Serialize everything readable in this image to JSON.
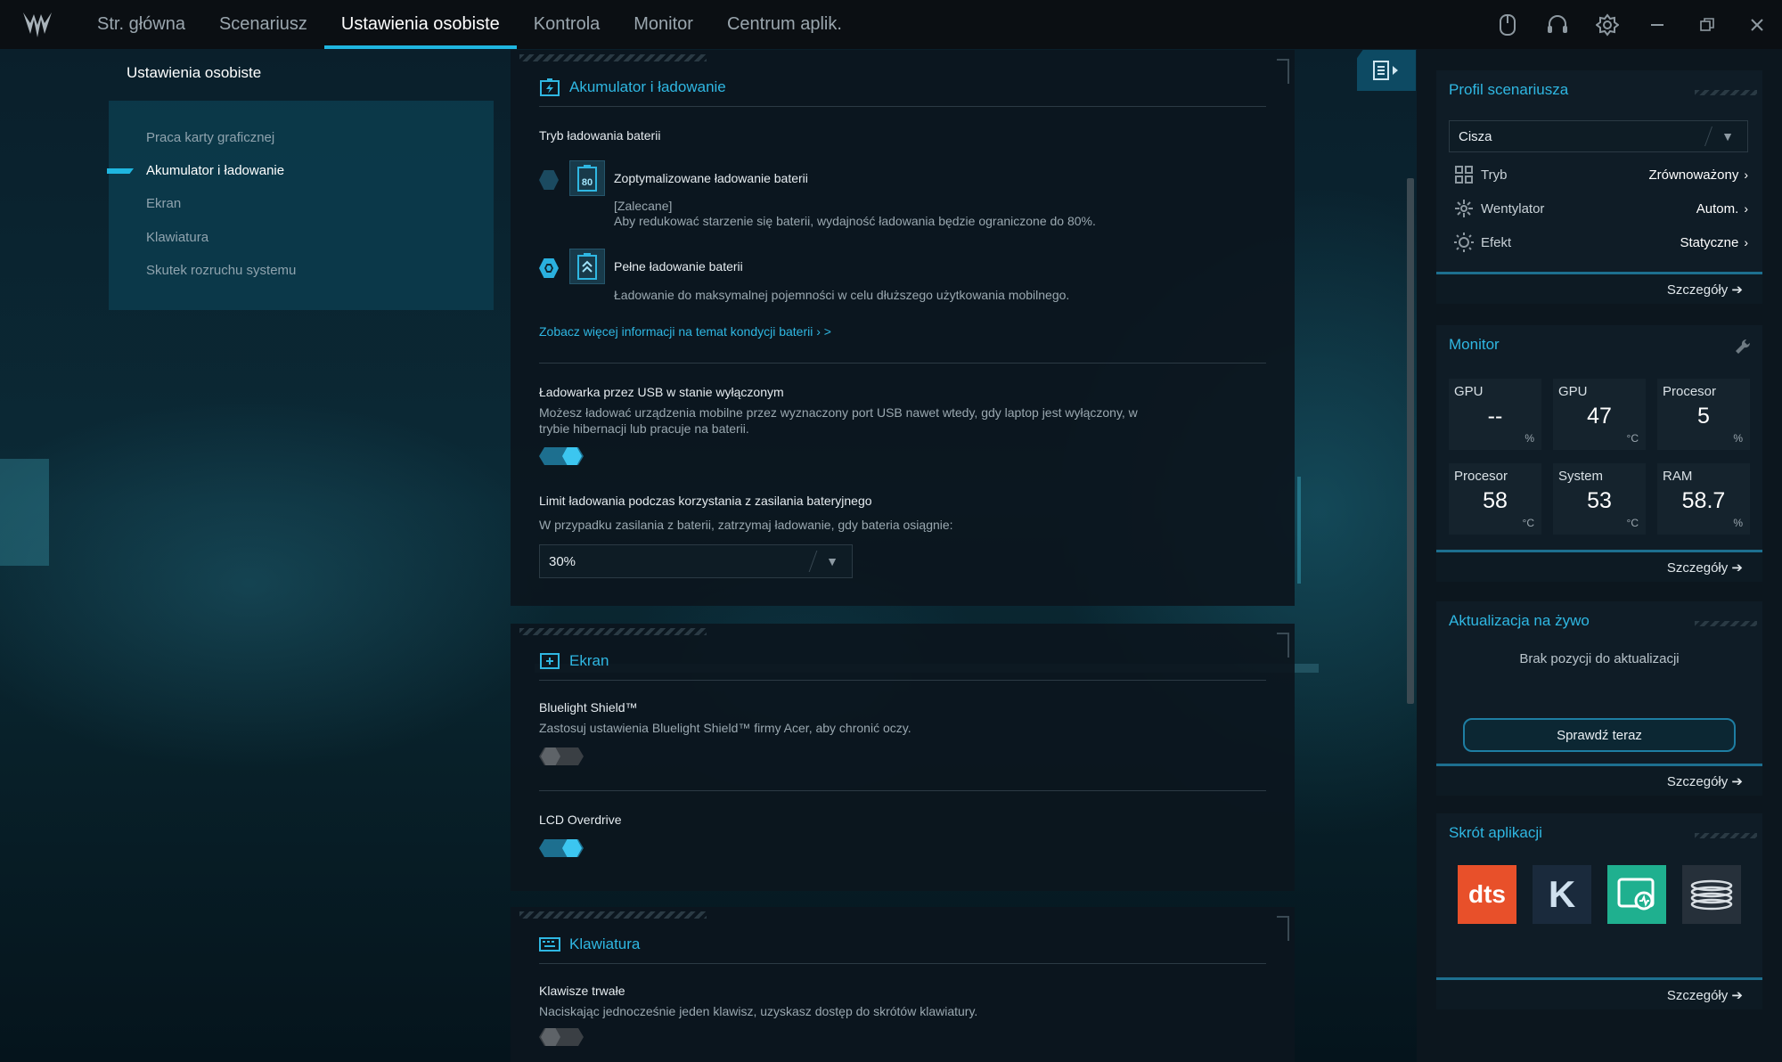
{
  "nav": {
    "items": [
      "Str. główna",
      "Scenariusz",
      "Ustawienia osobiste",
      "Kontrola",
      "Monitor",
      "Centrum aplik."
    ],
    "active_index": 2
  },
  "sidebar": {
    "title": "Ustawienia osobiste",
    "items": [
      {
        "label": "Praca karty graficznej"
      },
      {
        "label": "Akumulator i ładowanie"
      },
      {
        "label": "Ekran"
      },
      {
        "label": "Klawiatura"
      },
      {
        "label": "Skutek rozruchu systemu"
      }
    ],
    "active_index": 1
  },
  "battery": {
    "title": "Akumulator i ładowanie",
    "mode_label": "Tryb ładowania baterii",
    "opt1": {
      "icon_text": "80",
      "title": "Zoptymalizowane ładowanie baterii",
      "note": "[Zalecane]",
      "desc": "Aby redukować starzenie się baterii, wydajność ładowania będzie ograniczone do 80%.",
      "selected": false
    },
    "opt2": {
      "title": "Pełne ładowanie baterii",
      "desc": "Ładowanie do maksymalnej pojemności w celu dłuższego użytkowania mobilnego.",
      "selected": true
    },
    "more_link": "Zobacz więcej informacji na temat kondycji baterii › >",
    "usb": {
      "title": "Ładowarka przez USB w stanie wyłączonym",
      "desc1": "Możesz ładować urządzenia mobilne przez wyznaczony port USB nawet wtedy, gdy laptop jest wyłączony, w",
      "desc2": "trybie hibernacji lub pracuje na baterii.",
      "on": true
    },
    "limit": {
      "title": "Limit ładowania podczas korzystania z zasilania bateryjnego",
      "desc": "W przypadku zasilania z baterii, zatrzymaj ładowanie, gdy bateria osiągnie:",
      "value": "30%"
    }
  },
  "screen": {
    "title": "Ekran",
    "bluelight": {
      "title": "Bluelight Shield™",
      "desc": "Zastosuj ustawienia Bluelight Shield™ firmy Acer, aby chronić oczy.",
      "on": false
    },
    "overdrive": {
      "title": "LCD Overdrive",
      "on": true
    }
  },
  "keyboard": {
    "title": "Klawiatura",
    "sticky": {
      "title": "Klawisze trwałe",
      "desc": "Naciskając jednocześnie jeden klawisz, uzyskasz dostęp do skrótów klawiatury.",
      "on": false
    }
  },
  "profile": {
    "title": "Profil scenariusza",
    "selected": "Cisza",
    "rows": [
      {
        "key": "Tryb",
        "value": "Zrównoważony",
        "icon": "grid-icon"
      },
      {
        "key": "Wentylator",
        "value": "Autom.",
        "icon": "fan-icon"
      },
      {
        "key": "Efekt",
        "value": "Statyczne",
        "icon": "sun-icon"
      }
    ],
    "details": "Szczegóły"
  },
  "monitor": {
    "title": "Monitor",
    "tiles": [
      {
        "label": "GPU",
        "value": "--",
        "unit": "%"
      },
      {
        "label": "GPU",
        "value": "47",
        "unit": "°C"
      },
      {
        "label": "Procesor",
        "value": "5",
        "unit": "%"
      },
      {
        "label": "Procesor",
        "value": "58",
        "unit": "°C"
      },
      {
        "label": "System",
        "value": "53",
        "unit": "°C"
      },
      {
        "label": "RAM",
        "value": "58.7",
        "unit": "%"
      }
    ],
    "details": "Szczegóły"
  },
  "live_update": {
    "title": "Aktualizacja na żywo",
    "status": "Brak pozycji do aktualizacji",
    "button": "Sprawdź teraz",
    "details": "Szczegóły"
  },
  "shortcuts": {
    "title": "Skrót aplikacji",
    "apps": [
      {
        "name": "dts",
        "label": "dts",
        "color": "#e8502a"
      },
      {
        "name": "killer",
        "label": "K",
        "color": "#1a2a3c"
      },
      {
        "name": "monitor-app",
        "label": "",
        "color": "#1fb08f"
      },
      {
        "name": "coil-app",
        "label": "",
        "color": "#2a3238"
      }
    ],
    "details": "Szczegóły"
  },
  "colors": {
    "accent": "#2fb7e2",
    "toggle_on": "#3cc6f0"
  }
}
